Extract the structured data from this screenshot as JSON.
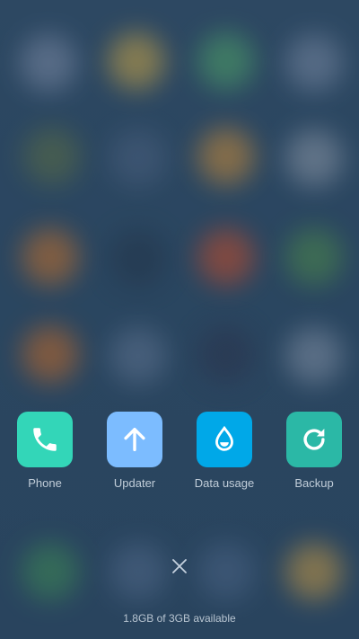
{
  "recents": [
    {
      "label": "Phone",
      "icon": "phone-icon",
      "color": "#33d6b8"
    },
    {
      "label": "Updater",
      "icon": "arrow-up-icon",
      "color": "#7cbcff"
    },
    {
      "label": "Data usage",
      "icon": "water-drop-icon",
      "color": "#00a8e8"
    },
    {
      "label": "Backup",
      "icon": "refresh-icon",
      "color": "#2bb8a6"
    }
  ],
  "close": {
    "icon": "close-icon"
  },
  "memory_text": "1.8GB of 3GB available",
  "colors": {
    "background": "#2d4a66",
    "label_text": "#ebf2fa"
  }
}
